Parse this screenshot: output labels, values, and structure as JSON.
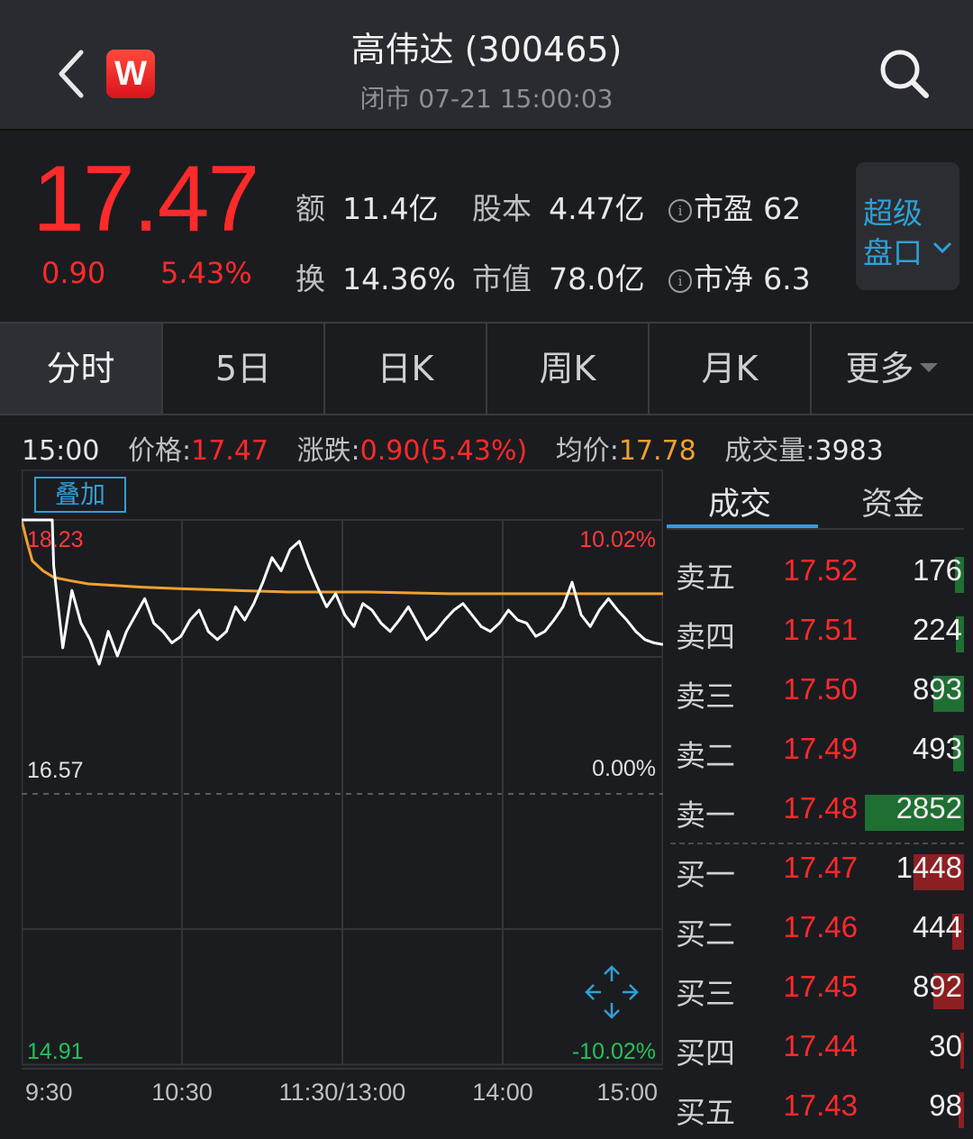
{
  "header": {
    "title": "高伟达 (300465)",
    "subtitle": "闭市 07-21 15:00:03",
    "logo_letter": "W",
    "back_icon": "chevron-left-icon",
    "search_icon": "search-icon"
  },
  "quote": {
    "price": "17.47",
    "change": "0.90",
    "change_pct": "5.43%",
    "stats": [
      {
        "label": "额",
        "value": "11.4亿"
      },
      {
        "label": "股本",
        "value": "4.47亿"
      },
      {
        "label": "市盈",
        "value": "62"
      },
      {
        "label": "换",
        "value": "14.36%"
      },
      {
        "label": "市值",
        "value": "78.0亿"
      },
      {
        "label": "市净",
        "value": "6.3"
      }
    ],
    "super_button": {
      "line1": "超级",
      "line2": "盘口"
    }
  },
  "tabs": [
    {
      "label": "分时",
      "active": true
    },
    {
      "label": "5日"
    },
    {
      "label": "日K"
    },
    {
      "label": "周K"
    },
    {
      "label": "月K"
    },
    {
      "label": "更多"
    }
  ],
  "info_row": {
    "time": "15:00",
    "price_label": "价格:",
    "price": "17.47",
    "change_label": "涨跌:",
    "change": "0.90(5.43%)",
    "avg_label": "均价:",
    "avg": "17.78",
    "volume_label": "成交量:",
    "volume": "3983"
  },
  "chart_overlay_label": "叠加",
  "chart_data": {
    "type": "line",
    "y_left_ticks": [
      "18.23",
      "16.57",
      "14.91"
    ],
    "y_right_ticks": [
      "10.02%",
      "0.00%",
      "-10.02%"
    ],
    "x_ticks": [
      "9:30",
      "10:30",
      "11:30/13:00",
      "14:00",
      "15:00"
    ],
    "ylim": [
      14.91,
      18.23
    ],
    "prev_close": 16.57,
    "series": [
      {
        "role": "price",
        "color": "#ffffff",
        "values": [
          18.23,
          18.23,
          18.23,
          18.23,
          18.23,
          18.23,
          18.23,
          18.23,
          18.23,
          18.23,
          18.23,
          18.23,
          18.23,
          18.23,
          18.23,
          18.23,
          18.23,
          18.23,
          18.23,
          18.23,
          18.23,
          18.23,
          17.95,
          17.45,
          17.8,
          17.6,
          17.5,
          17.35,
          17.55,
          17.4,
          17.55,
          17.65,
          17.75,
          17.6,
          17.55,
          17.48,
          17.52,
          17.62,
          17.68,
          17.55,
          17.5,
          17.55,
          17.7,
          17.62,
          17.72,
          17.85,
          18.0,
          17.92,
          18.05,
          18.1,
          17.95,
          17.82,
          17.7,
          17.78,
          17.65,
          17.58,
          17.72,
          17.68,
          17.6,
          17.55,
          17.62,
          17.7,
          17.6,
          17.5,
          17.55,
          17.62,
          17.68,
          17.72,
          17.65,
          17.58,
          17.55,
          17.6,
          17.68,
          17.62,
          17.6,
          17.52,
          17.55,
          17.62,
          17.7,
          17.85,
          17.65,
          17.58,
          17.68,
          17.75,
          17.68,
          17.62,
          17.55,
          17.5,
          17.48,
          17.47
        ],
        "x_minutes": [
          0,
          1,
          2,
          3,
          4,
          5,
          6,
          7,
          8,
          9,
          10,
          11,
          12,
          13,
          14,
          15,
          16,
          17,
          18,
          19,
          20,
          21,
          22,
          23,
          28,
          35,
          40,
          48,
          55,
          62,
          68,
          75,
          80,
          86,
          92,
          98,
          104,
          110,
          116,
          122,
          128,
          134,
          140,
          146,
          150,
          154,
          158,
          162,
          166,
          170,
          174,
          178,
          182,
          186,
          190,
          194,
          198,
          202,
          206,
          210,
          214,
          218,
          222,
          226,
          230,
          234,
          238,
          256,
          258,
          260,
          262,
          264,
          266,
          268,
          270,
          272,
          274,
          276,
          278,
          218,
          224,
          230,
          236,
          240,
          240,
          240,
          240,
          240,
          240,
          240
        ]
      },
      {
        "role": "average",
        "color": "#f0a030",
        "values": [
          18.23,
          18.1,
          17.98,
          17.92,
          17.88,
          17.86,
          17.84,
          17.83,
          17.82,
          17.81,
          17.8,
          17.79,
          17.79,
          17.78,
          17.78,
          17.78,
          17.78
        ],
        "x_minutes": [
          0,
          2,
          4,
          8,
          12,
          18,
          25,
          35,
          45,
          60,
          80,
          100,
          130,
          160,
          190,
          220,
          240
        ]
      }
    ]
  },
  "order_book": {
    "tabs": [
      "成交",
      "资金"
    ],
    "asks": [
      {
        "label": "卖五",
        "price": "17.52",
        "volume": "176",
        "bar": 0.09
      },
      {
        "label": "卖四",
        "price": "17.51",
        "volume": "224",
        "bar": 0.08
      },
      {
        "label": "卖三",
        "price": "17.50",
        "volume": "893",
        "bar": 0.31
      },
      {
        "label": "卖二",
        "price": "17.49",
        "volume": "493",
        "bar": 0.11
      },
      {
        "label": "卖一",
        "price": "17.48",
        "volume": "2852",
        "bar": 1.0
      }
    ],
    "bids": [
      {
        "label": "买一",
        "price": "17.47",
        "volume": "1448",
        "bar": 0.51
      },
      {
        "label": "买二",
        "price": "17.46",
        "volume": "444",
        "bar": 0.12
      },
      {
        "label": "买三",
        "price": "17.45",
        "volume": "892",
        "bar": 0.31
      },
      {
        "label": "买四",
        "price": "17.44",
        "volume": "30",
        "bar": 0.04
      },
      {
        "label": "买五",
        "price": "17.43",
        "volume": "98",
        "bar": 0.05
      }
    ]
  },
  "colors": {
    "up": "#ff2a2a",
    "down": "#22c35a",
    "accent": "#2fa0d6",
    "avg_line": "#f0a030",
    "ask_bar": "#1f6f33",
    "bid_bar": "#8c1f22"
  },
  "icons": {
    "expand": "expand-arrows-icon",
    "info": "info-icon",
    "dropdown": "chevron-down-icon"
  }
}
